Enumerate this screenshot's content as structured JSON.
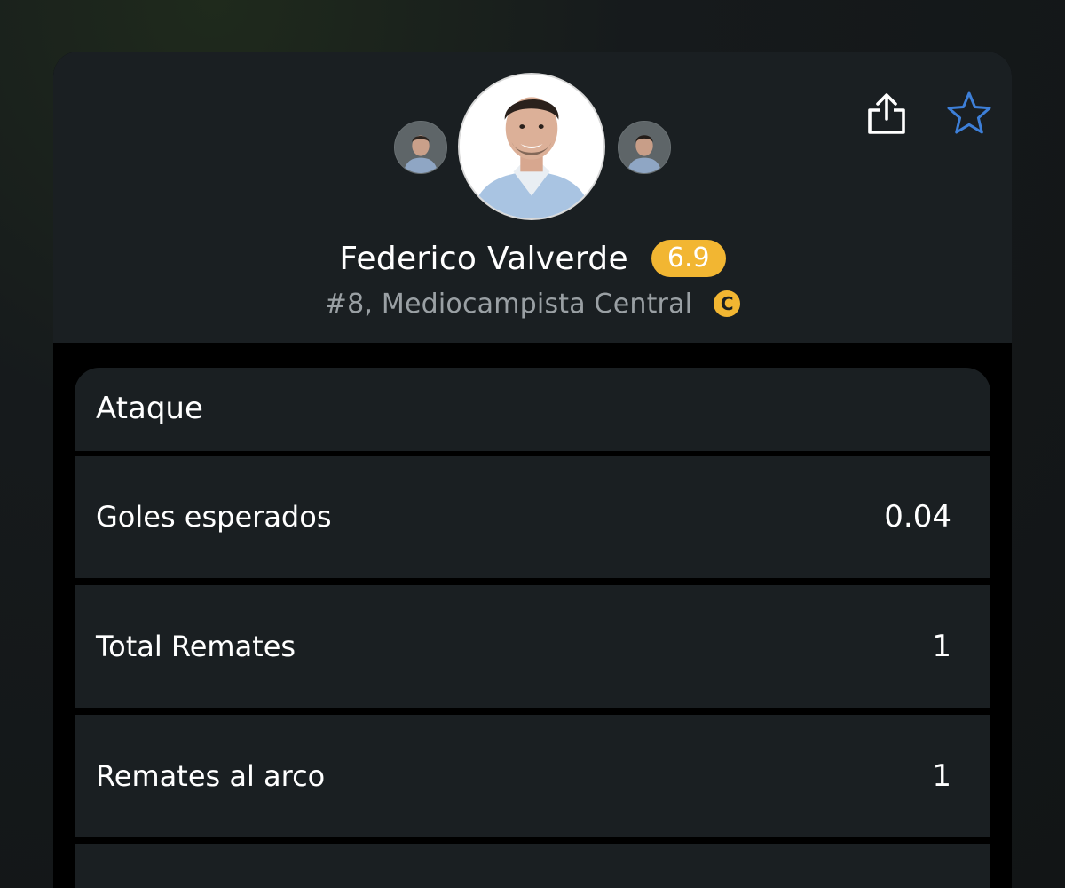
{
  "player": {
    "name": "Federico Valverde",
    "rating": "6.9",
    "position": "#8, Mediocampista Central",
    "captain_badge": "C"
  },
  "colors": {
    "rating_badge": "#f2b632",
    "panel": "#1a1f22",
    "muted_text": "#9aa0a4"
  },
  "header": {
    "actions": [
      {
        "name": "share",
        "icon": "share-icon"
      },
      {
        "name": "favorite",
        "icon": "star-icon"
      }
    ]
  },
  "section": {
    "title": "Ataque",
    "stats": [
      {
        "label": "Goles esperados",
        "value": "0.04"
      },
      {
        "label": "Total Remates",
        "value": "1"
      },
      {
        "label": "Remates al arco",
        "value": "1"
      }
    ]
  }
}
